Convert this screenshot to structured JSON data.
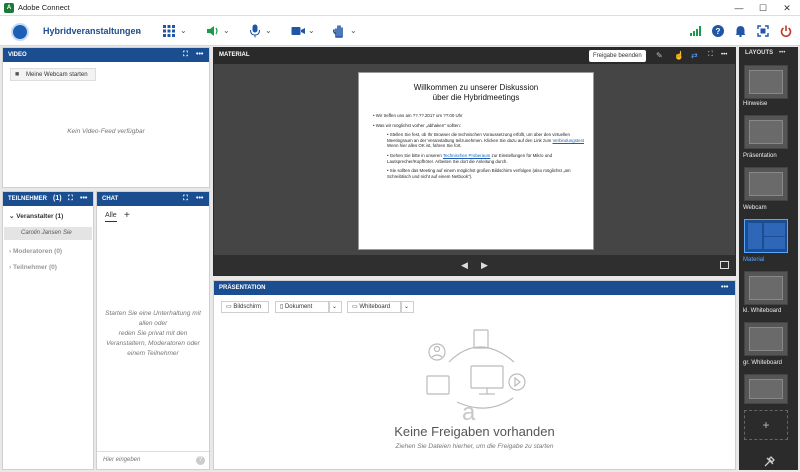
{
  "window": {
    "title": "Adobe Connect",
    "logo_letter": "A",
    "minimize": "—",
    "maximize": "☐",
    "close": "✕"
  },
  "menubar": {
    "room_name": "Hybridveranstaltungen",
    "chevron": "⌄"
  },
  "video_pod": {
    "title": "VIDEO",
    "more": "•••",
    "start_webcam": "Meine Webcam starten",
    "empty": "Kein Video-Feed verfügbar"
  },
  "attendees_pod": {
    "title": "TEILNEHMER",
    "count": "(1)",
    "more": "•••",
    "groups": [
      {
        "label": "Veranstalter (1)",
        "expanded": true
      },
      {
        "label": "Moderatoren (0)",
        "expanded": false
      },
      {
        "label": "Teilnehmer (0)",
        "expanded": false
      }
    ],
    "member": {
      "name": "Carolin Jansen",
      "suffix": "Sie"
    }
  },
  "chat_pod": {
    "title": "CHAT",
    "more": "•••",
    "tab_all": "Alle",
    "add": "+",
    "info_lines": [
      "Starten Sie eine Unterhaltung mit",
      "allen oder",
      "reden Sie privat mit den",
      "Veranstaltern, Moderatoren oder",
      "einem Teilnehmer"
    ],
    "input_placeholder": "Hier eingeben",
    "help": "?"
  },
  "material_pod": {
    "title": "MATERIAL",
    "stop_sharing": "Freigabe beenden",
    "more": "•••",
    "slide": {
      "title_line1": "Willkommen zu unserer Diskussion",
      "title_line2": "über die Hybridmeetings",
      "bullet1": "Wir treffen uns am ??.??.2017 um ??:00 Uhr",
      "bullet2": "Was wir möglichst vorher „abhaken\" sollten:",
      "sub1": "Stellen Sie fest, ob Ihr Browser die technischen Voraussetzung erfüllt, um über den virtuellen Meetingraum an der Veranstaltung teilzunehmen. Klicken Sie dazu auf den Link zum",
      "sub1_link": "Verbindungstest",
      "sub1_tail": "Wenn hier alles OK ist, fahren Sie fort.",
      "sub2_pre": "Gehen Sie bitte in unseren",
      "sub2_link": "Technischen Proberaum",
      "sub2_tail": "zur Einstellungen für Mikro und Lautsprecher/Kopfhörer. Arbeiten Sie dort die Anleitung durch.",
      "sub3": "Sie sollten das Meeting auf einem möglichst großen Bildschirm verfolgen (also möglichst „am Schreibtisch und nicht auf einem Netbook\")."
    },
    "prev": "◀",
    "next": "▶"
  },
  "presentation_pod": {
    "title": "PRÄSENTATION",
    "more": "•••",
    "buttons": [
      "Bildschirm",
      "Dokument",
      "Whiteboard"
    ],
    "dropdown": "⌄",
    "empty_title": "Keine Freigaben vorhanden",
    "empty_sub": "Ziehen Sie Dateien hierher, um die Freigabe zu starten",
    "letter_a": "a"
  },
  "layouts": {
    "title": "LAYOUTS",
    "more": "•••",
    "items": [
      "Hinweise",
      "Präsentation",
      "Webcam",
      "Material",
      "kl. Whiteboard",
      "gr. Whiteboard"
    ],
    "active": "Material",
    "add": "+"
  },
  "colors": {
    "accent": "#1b4e91",
    "link": "#1d5fb5",
    "active_layout": "#5aa7ff"
  }
}
